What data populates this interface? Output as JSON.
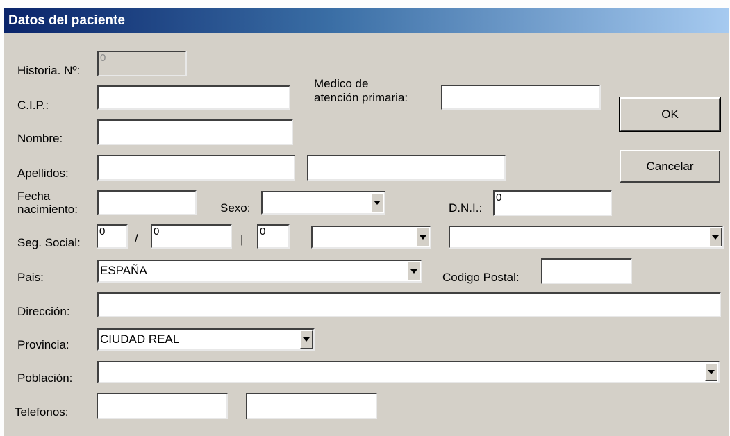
{
  "window": {
    "title": "Datos del paciente"
  },
  "labels": {
    "historia": "Historia. Nº:",
    "cip": "C.I.P.:",
    "medico_line1": "Medico de",
    "medico_line2": "atención primaria:",
    "nombre": "Nombre:",
    "apellidos": "Apellidos:",
    "fecha_line1": "Fecha",
    "fecha_line2": "nacimiento:",
    "sexo": "Sexo:",
    "dni": "D.N.I.:",
    "seg_social": "Seg. Social:",
    "slash": "/",
    "bar": "|",
    "pais": "Pais:",
    "codigo_postal": "Codigo Postal:",
    "direccion": "Dirección:",
    "provincia": "Provincia:",
    "poblacion": "Población:",
    "telefonos": "Telefonos:"
  },
  "fields": {
    "historia": "0",
    "cip": "",
    "medico": "",
    "nombre": "",
    "apellido1": "",
    "apellido2": "",
    "fecha_nacimiento": "",
    "sexo": "",
    "dni": "0",
    "seg_social_1": "0",
    "seg_social_2": "0",
    "seg_social_3": "0",
    "seg_social_combo1": "",
    "seg_social_combo2": "",
    "pais": "ESPAÑA",
    "codigo_postal": "",
    "direccion": "",
    "provincia": "CIUDAD REAL",
    "poblacion": "",
    "telefono1": "",
    "telefono2": ""
  },
  "buttons": {
    "ok": "OK",
    "cancel": "Cancelar"
  }
}
